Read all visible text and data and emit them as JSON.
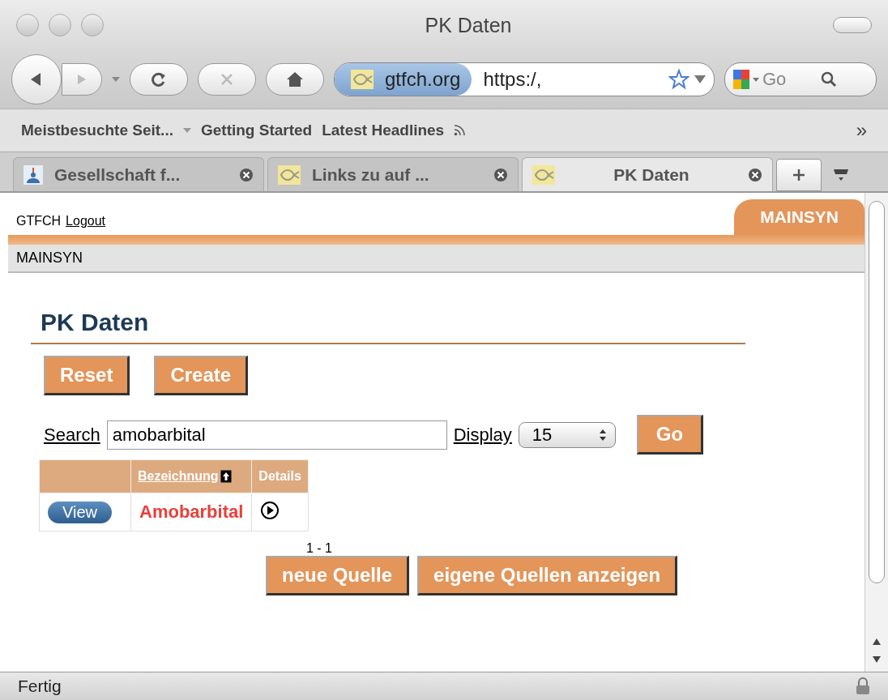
{
  "window": {
    "title": "PK Daten"
  },
  "toolbar": {
    "address": {
      "site": "gtfch.org",
      "url": "https:/,"
    },
    "search": {
      "placeholder": "Go"
    }
  },
  "bookmarks": [
    {
      "label": "Meistbesuchte Seit...",
      "kind": "menu"
    },
    {
      "label": "Getting Started",
      "kind": "link"
    },
    {
      "label": "Latest Headlines",
      "kind": "feed"
    }
  ],
  "bookmarks_overflow": "»",
  "tabs": [
    {
      "label": "Gesellschaft f...",
      "selected": false,
      "kind": "figure"
    },
    {
      "label": "Links zu auf ...",
      "selected": false,
      "kind": "site"
    },
    {
      "label": "PK Daten",
      "selected": true,
      "kind": "site"
    }
  ],
  "page": {
    "site_name": "GTFCH",
    "logout": "Logout",
    "section_tab": "MAINSYN",
    "breadcrumb": "MAINSYN",
    "heading": "PK Daten",
    "actions": [
      "Reset",
      "Create"
    ],
    "search": {
      "label": "Search",
      "value": "amobarbital"
    },
    "display": {
      "label": "Display",
      "value": "15"
    },
    "go": "Go",
    "table": {
      "columns": [
        {
          "label": "Bezeichnung",
          "sorted": true
        },
        {
          "label": "Details",
          "sorted": false
        }
      ],
      "rows": [
        {
          "action": "View",
          "name": "Amobarbital"
        }
      ]
    },
    "pagination": "1 - 1",
    "buttons": [
      "neue Quelle",
      "eigene Quellen anzeigen"
    ]
  },
  "status_bar": {
    "text": "Fertig"
  }
}
